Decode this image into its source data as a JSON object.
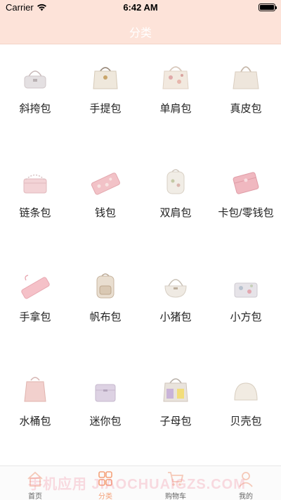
{
  "status_bar": {
    "carrier": "Carrier",
    "time": "6:42 AM"
  },
  "nav": {
    "title": "分类"
  },
  "categories": [
    {
      "label": "斜挎包",
      "icon": "crossbody-bag-icon"
    },
    {
      "label": "手提包",
      "icon": "handbag-icon"
    },
    {
      "label": "单肩包",
      "icon": "shoulder-bag-icon"
    },
    {
      "label": "真皮包",
      "icon": "leather-bag-icon"
    },
    {
      "label": "链条包",
      "icon": "chain-bag-icon"
    },
    {
      "label": "钱包",
      "icon": "wallet-icon"
    },
    {
      "label": "双肩包",
      "icon": "backpack-icon"
    },
    {
      "label": "卡包/零钱包",
      "icon": "card-holder-icon"
    },
    {
      "label": "手拿包",
      "icon": "clutch-icon"
    },
    {
      "label": "帆布包",
      "icon": "canvas-bag-icon"
    },
    {
      "label": "小猪包",
      "icon": "piggy-bag-icon"
    },
    {
      "label": "小方包",
      "icon": "square-bag-icon"
    },
    {
      "label": "水桶包",
      "icon": "bucket-bag-icon"
    },
    {
      "label": "迷你包",
      "icon": "mini-bag-icon"
    },
    {
      "label": "子母包",
      "icon": "mother-bag-icon"
    },
    {
      "label": "贝壳包",
      "icon": "shell-bag-icon"
    }
  ],
  "tabs": [
    {
      "label": "首页",
      "icon": "home-icon",
      "active": false
    },
    {
      "label": "分类",
      "icon": "category-icon",
      "active": true
    },
    {
      "label": "购物车",
      "icon": "cart-icon",
      "active": false
    },
    {
      "label": "我的",
      "icon": "profile-icon",
      "active": false
    }
  ],
  "watermark": "手机应用 JIAOCHUAIGZS.COM",
  "colors": {
    "header_bg": "#fde3d9",
    "active_tab": "#f5a27a",
    "bag_pink": "#f0c6cc",
    "bag_cream": "#ede4dc",
    "bag_white": "#f5f2ee"
  }
}
